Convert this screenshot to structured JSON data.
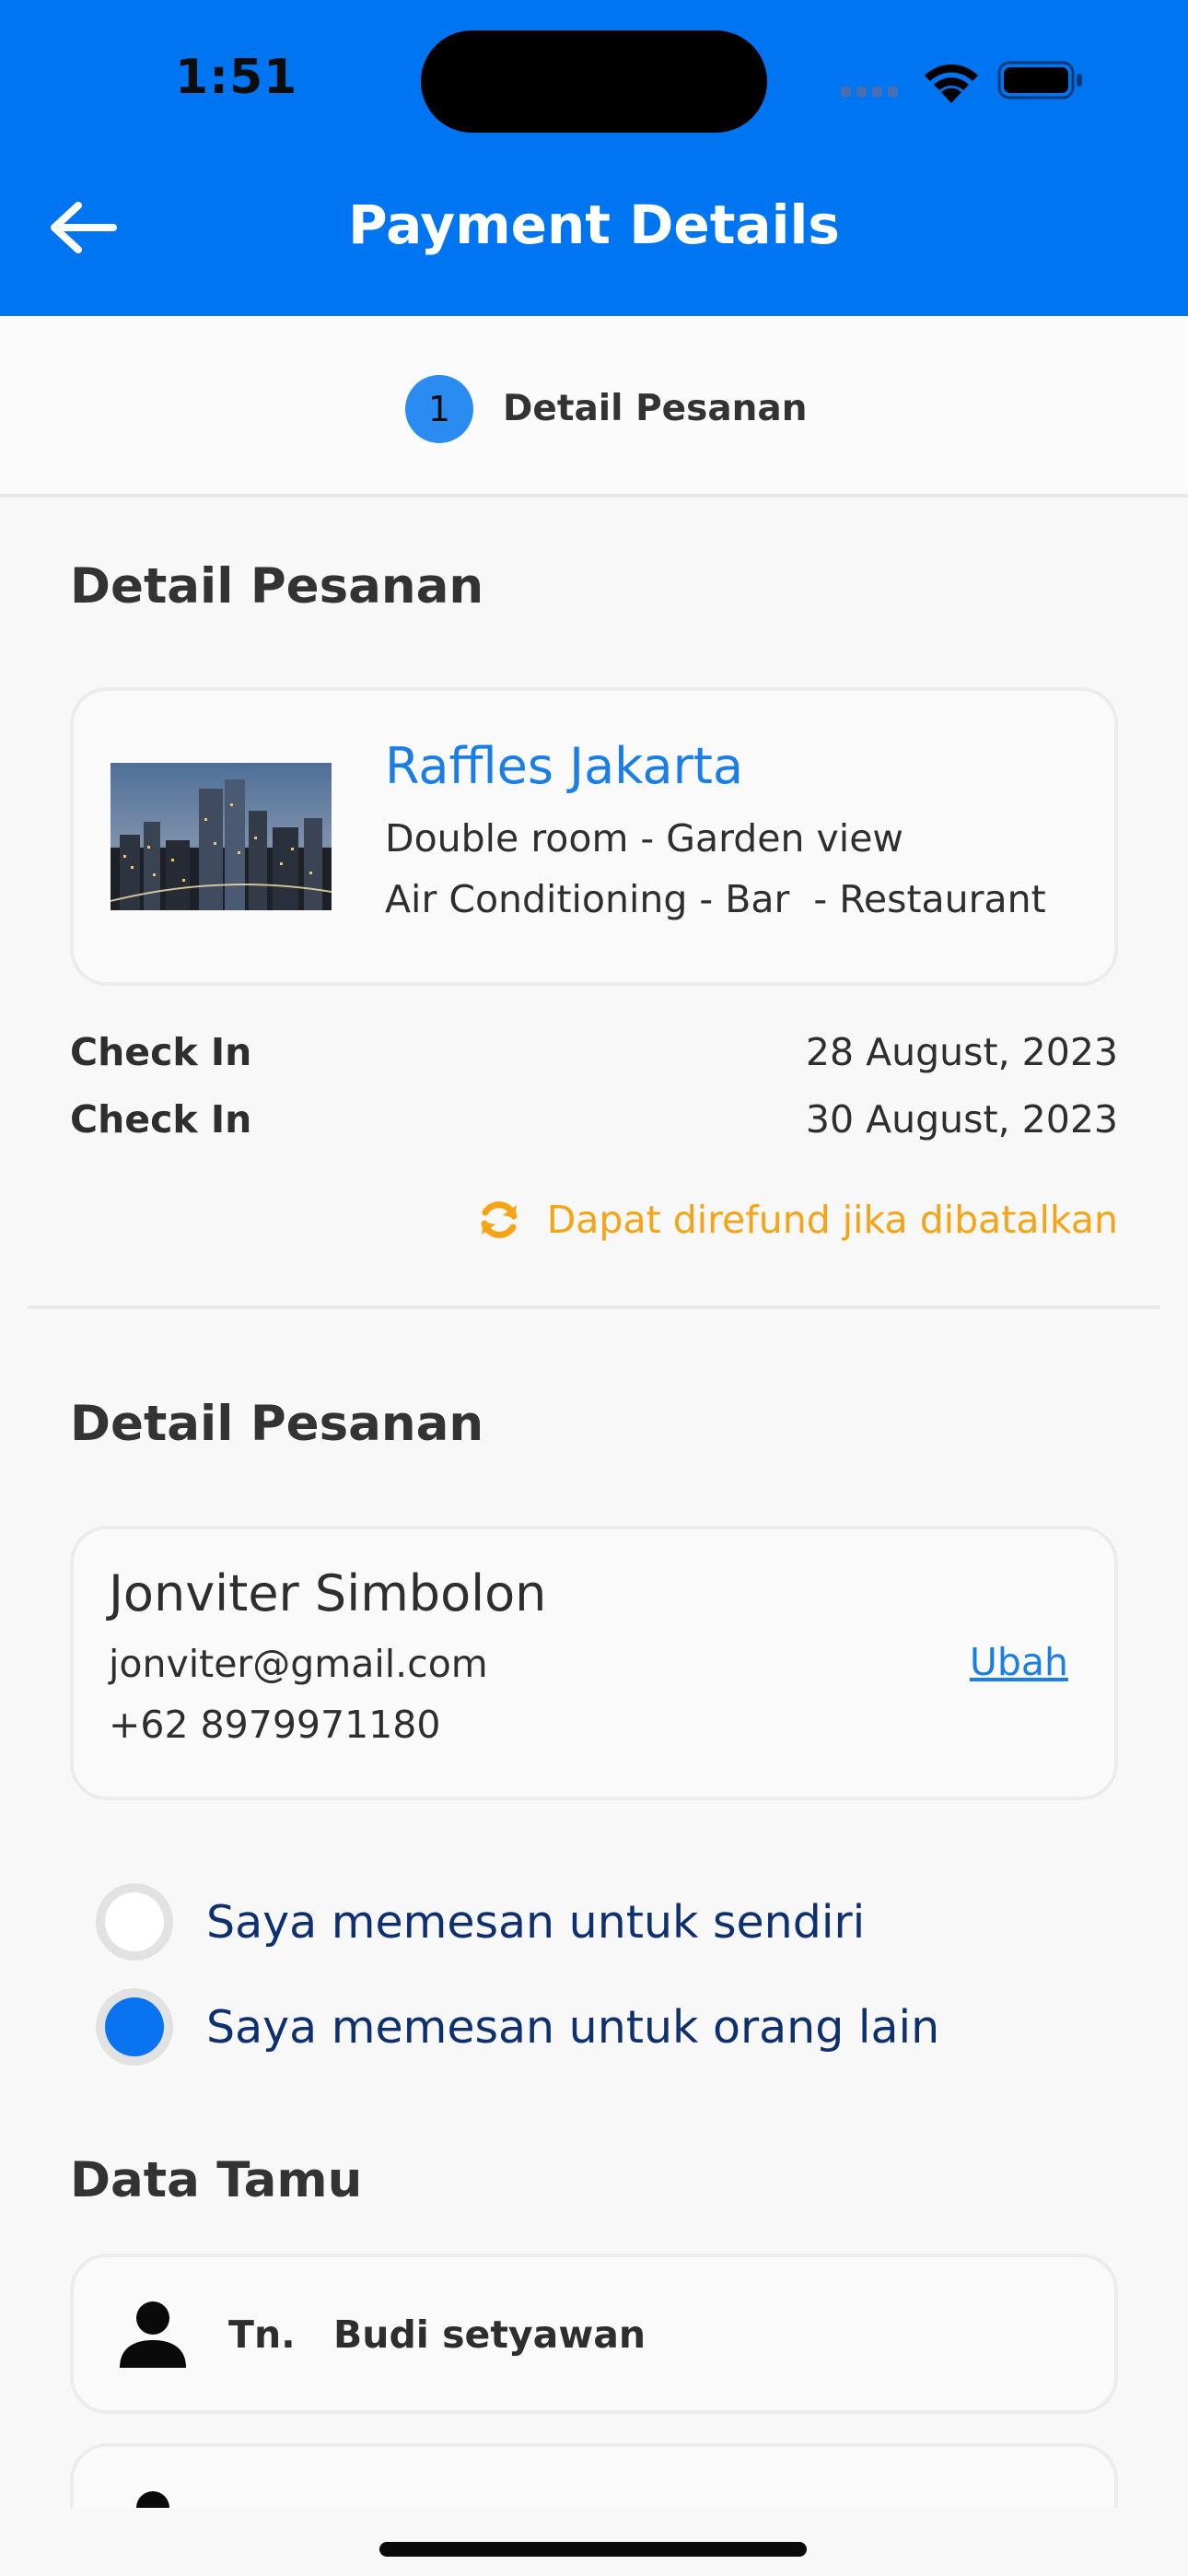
{
  "status_bar": {
    "time": "1:51"
  },
  "header": {
    "title": "Payment Details",
    "back_icon": "arrow-left-icon",
    "background": "#0075f2"
  },
  "stepper": {
    "step_number": "1",
    "step_label": "Detail Pesanan"
  },
  "order_section": {
    "title": "Detail Pesanan",
    "hotel": {
      "name": "Raffles Jakarta",
      "room": "Double room - Garden view",
      "facilities": "Air Conditioning - Bar  - Restaurant"
    },
    "check_in_label": "Check In",
    "check_in_date": "28 August, 2023",
    "check_out_label": "Check In",
    "check_out_date": "30 August, 2023",
    "refund_text": "Dapat direfund jika dibatalkan",
    "refund_icon": "refresh-icon",
    "refund_color": "#f6a316"
  },
  "contact_section": {
    "title": "Detail Pesanan",
    "name": "Jonviter Simbolon",
    "email": "jonviter@gmail.com",
    "phone": "+62 8979971180",
    "edit_label": "Ubah"
  },
  "booking_for": {
    "options": [
      {
        "label": "Saya memesan untuk sendiri",
        "selected": false
      },
      {
        "label": "Saya memesan untuk orang lain",
        "selected": true
      }
    ]
  },
  "guest_section": {
    "title": "Data Tamu",
    "guests": [
      {
        "title": "Tn.",
        "name": "Budi setyawan",
        "icon": "person-icon"
      }
    ]
  }
}
